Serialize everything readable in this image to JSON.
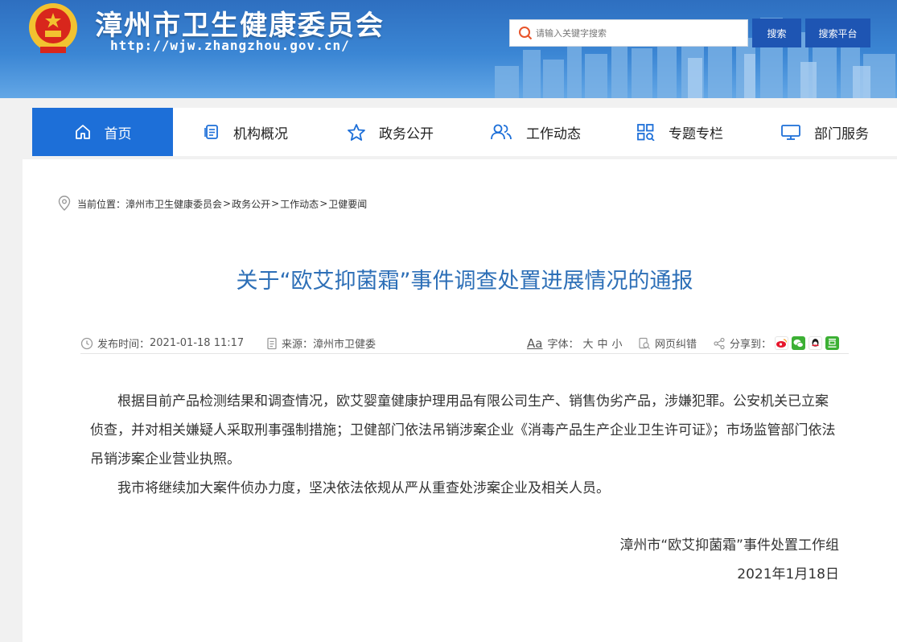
{
  "header": {
    "site_title": "漳州市卫生健康委员会",
    "site_url": "http://wjw.zhangzhou.gov.cn/",
    "search_placeholder": "请输入关键字搜索",
    "search_button": "搜索",
    "platform_button": "搜索平台"
  },
  "nav": {
    "items": [
      {
        "label": "首页",
        "icon": "home-icon"
      },
      {
        "label": "机构概况",
        "icon": "document-icon"
      },
      {
        "label": "政务公开",
        "icon": "star-icon"
      },
      {
        "label": "工作动态",
        "icon": "users-icon"
      },
      {
        "label": "专题专栏",
        "icon": "grid-search-icon"
      },
      {
        "label": "部门服务",
        "icon": "monitor-icon"
      }
    ]
  },
  "breadcrumb": {
    "prefix": "当前位置：",
    "items": [
      "漳州市卫生健康委员会",
      "政务公开",
      "工作动态",
      "卫健要闻"
    ],
    "separator": ">"
  },
  "article": {
    "title": "关于“欧艾抑菌霜”事件调查处置进展情况的通报",
    "publish_label": "发布时间：",
    "publish_time": "2021-01-18 11:17",
    "source_label": "来源：",
    "source": "漳州市卫健委",
    "font_glyph": "Aa",
    "font_label": "字体：",
    "font_sizes": [
      "大",
      "中",
      "小"
    ],
    "correction": "网页纠错",
    "share_label": "分享到：",
    "paragraphs": [
      "根据目前产品检测结果和调查情况，欧艾婴童健康护理用品有限公司生产、销售伪劣产品，涉嫌犯罪。公安机关已立案侦查，并对相关嫌疑人采取刑事强制措施；卫健部门依法吊销涉案企业《消毒产品生产企业卫生许可证》；市场监管部门依法吊销涉案企业营业执照。",
      "我市将继续加大案件侦办力度，坚决依法依规从严从重查处涉案企业及相关人员。"
    ],
    "signature": "漳州市“欧艾抑菌霜”事件处置工作组",
    "date": "2021年1月18日"
  },
  "colors": {
    "header_blue": "#3b86d4",
    "nav_active": "#1d6fd8",
    "title_blue": "#2d6fb7",
    "button_blue": "#1e55b3"
  }
}
